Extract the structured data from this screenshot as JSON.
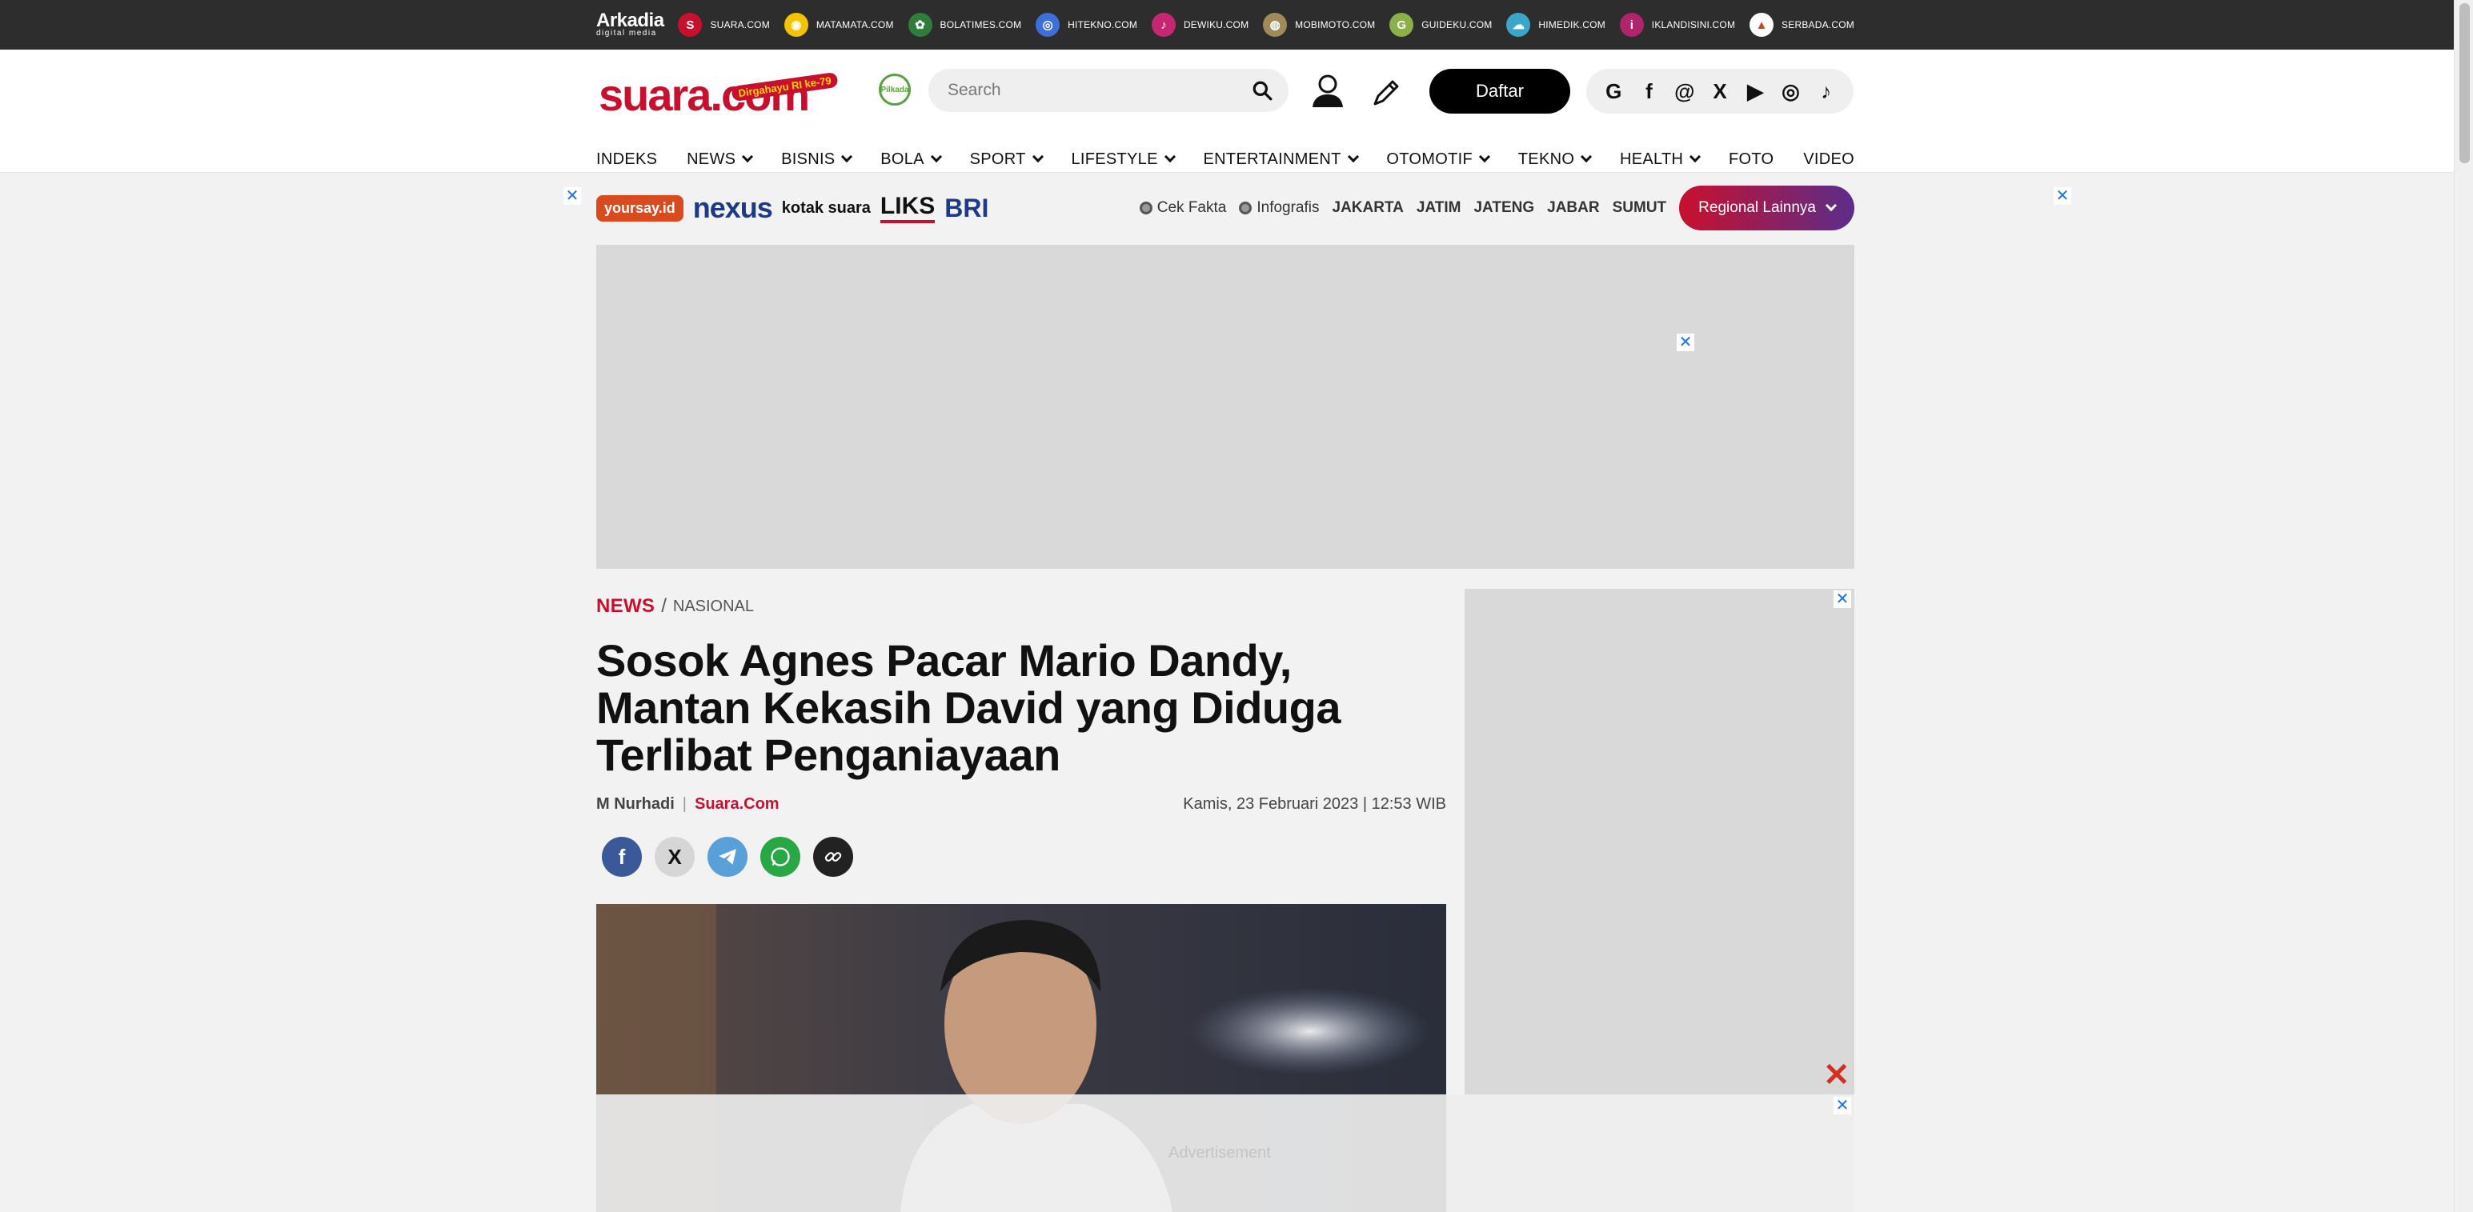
{
  "network": {
    "logo": "Arkadia",
    "logo_sub": "digital media",
    "sites": [
      {
        "label": "SUARA.COM",
        "glyph": "S",
        "color": "#c8102e"
      },
      {
        "label": "MATAMATA.COM",
        "glyph": "◉",
        "color": "#f3c300"
      },
      {
        "label": "BOLATIMES.COM",
        "glyph": "✿",
        "color": "#2f7d3a"
      },
      {
        "label": "HITEKNO.COM",
        "glyph": "◎",
        "color": "#3d6fd8"
      },
      {
        "label": "DEWIKU.COM",
        "glyph": "♪",
        "color": "#c72772"
      },
      {
        "label": "MOBIMOTO.COM",
        "glyph": "◍",
        "color": "#a08a5a"
      },
      {
        "label": "GUIDEKU.COM",
        "glyph": "G",
        "color": "#8ab04a"
      },
      {
        "label": "HIMEDIK.COM",
        "glyph": "☁",
        "color": "#3aa6c9"
      },
      {
        "label": "IKLANDISINI.COM",
        "glyph": "i",
        "color": "#b0246b"
      },
      {
        "label": "SERBADA.COM",
        "glyph": "▲",
        "color": "#ffffff"
      }
    ]
  },
  "header": {
    "brand": "suara.com",
    "brand_badge": "Dirgahayu RI ke-79",
    "green_badge": "Pilkada",
    "search_placeholder": "Search",
    "register_label": "Daftar",
    "socials": [
      "G",
      "f",
      "@",
      "X",
      "▶",
      "◎",
      "♪"
    ],
    "nav": [
      {
        "label": "INDEKS",
        "dropdown": false
      },
      {
        "label": "NEWS",
        "dropdown": true
      },
      {
        "label": "BISNIS",
        "dropdown": true
      },
      {
        "label": "BOLA",
        "dropdown": true
      },
      {
        "label": "SPORT",
        "dropdown": true
      },
      {
        "label": "LIFESTYLE",
        "dropdown": true
      },
      {
        "label": "ENTERTAINMENT",
        "dropdown": true
      },
      {
        "label": "OTOMOTIF",
        "dropdown": true
      },
      {
        "label": "TEKNO",
        "dropdown": true
      },
      {
        "label": "HEALTH",
        "dropdown": true
      },
      {
        "label": "FOTO",
        "dropdown": false
      },
      {
        "label": "VIDEO",
        "dropdown": false
      }
    ]
  },
  "subnav": {
    "partners": [
      "yoursay.id",
      "nexus",
      "kotak suara",
      "LIKS",
      "BRI"
    ],
    "links": {
      "cek_fakta": "Cek Fakta",
      "infografis": "Infografis",
      "jakarta": "JAKARTA",
      "jatim": "JATIM",
      "jateng": "JATENG",
      "jabar": "JABAR",
      "sumut": "SUMUT"
    },
    "regional_label": "Regional Lainnya"
  },
  "article": {
    "section": "NEWS",
    "subsection": "NASIONAL",
    "title": "Sosok Agnes Pacar Mario Dandy, Mantan Kekasih David yang Diduga Terlibat Penganiayaan",
    "author": "M Nurhadi",
    "outlet": "Suara.Com",
    "date": "Kamis, 23 Februari 2023 | 12:53 WIB"
  },
  "ads": {
    "label": "Advertisement",
    "close_glyph": "✕"
  },
  "colors": {
    "brand_red": "#c8102e",
    "topbar": "#2d2d2d",
    "ad_gray": "#d9d9d9"
  }
}
